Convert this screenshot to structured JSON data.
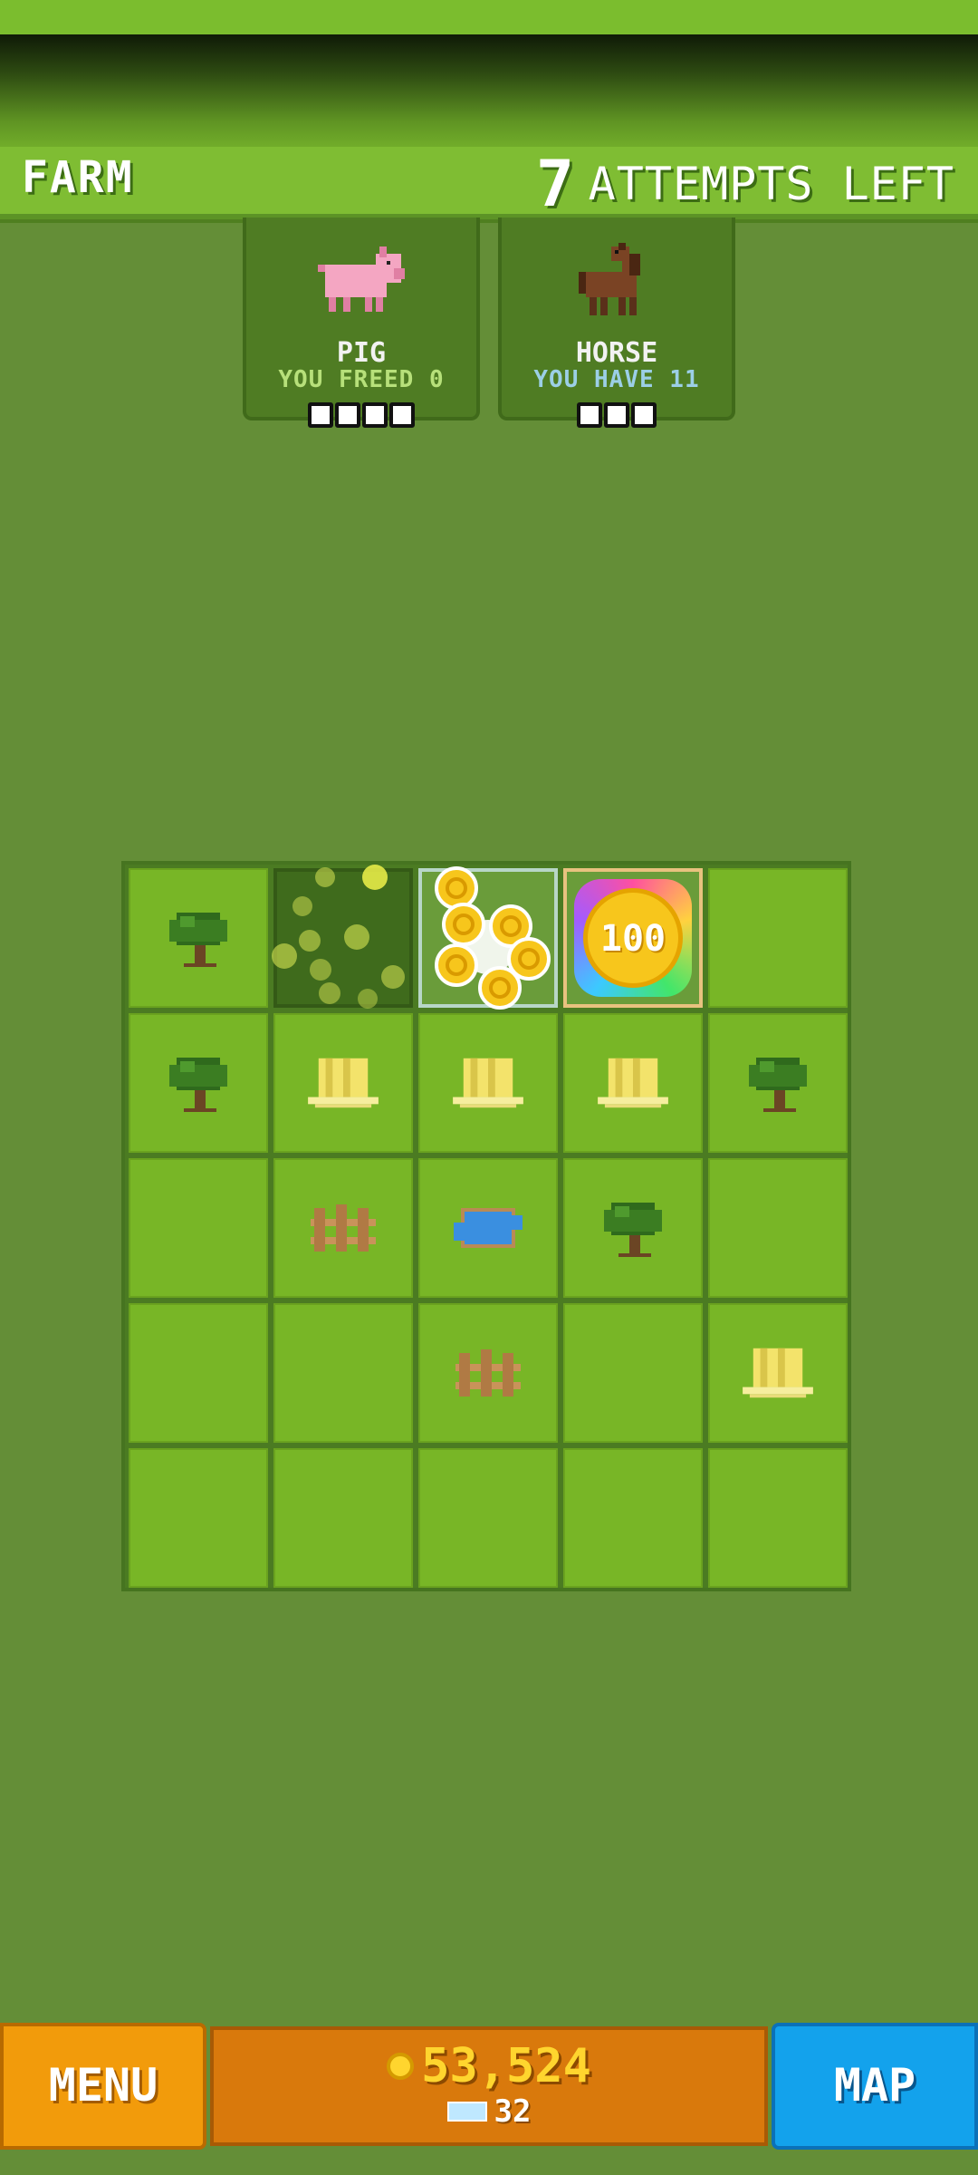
{
  "header": {
    "title": "FARM",
    "attempts_number": "7",
    "attempts_label": "ATTEMPTS LEFT"
  },
  "cards": [
    {
      "name": "PIG",
      "status": "YOU FREED 0",
      "status_color": "#b7e07a",
      "slots": 4
    },
    {
      "name": "HORSE",
      "status": "YOU HAVE 11",
      "status_color": "#9ccfe6",
      "slots": 3
    }
  ],
  "grid": {
    "rows": [
      [
        "tree",
        "dark-bubbles",
        "coin-burst",
        "coin-100",
        "empty"
      ],
      [
        "tree",
        "hay",
        "hay",
        "hay",
        "tree"
      ],
      [
        "empty",
        "fence",
        "pond",
        "tree",
        "empty"
      ],
      [
        "empty",
        "empty",
        "fence",
        "empty",
        "hay"
      ],
      [
        "empty",
        "empty",
        "empty",
        "empty",
        "empty"
      ]
    ],
    "coin_value": "100"
  },
  "bottom": {
    "menu_label": "MENU",
    "map_label": "MAP",
    "coins": "53,524",
    "gems": "32"
  },
  "colors": {
    "background": "#648e37",
    "header": "#7fbd33",
    "menu_button": "#f29b0b",
    "map_button": "#13a2ec",
    "wallet": "#d9790c"
  }
}
